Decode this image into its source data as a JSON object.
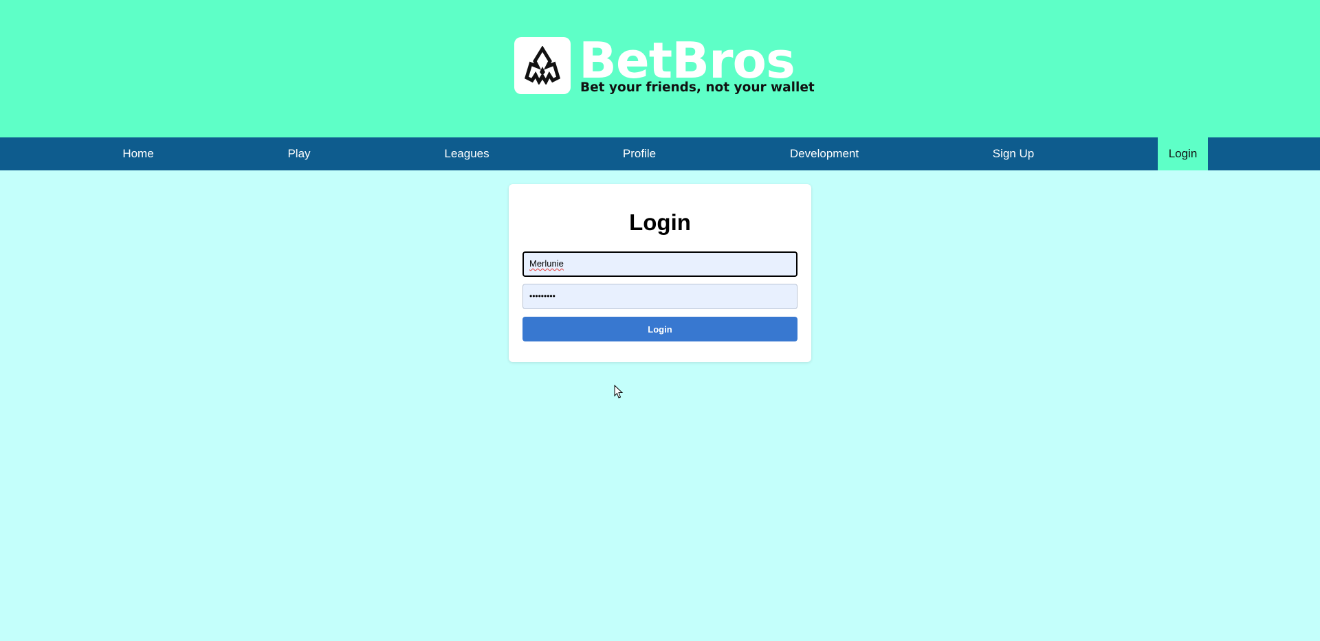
{
  "brand": {
    "name": "BetBros",
    "tagline": "Bet your friends, not your wallet",
    "logo_icon": "flame-crown-icon",
    "header_color": "#5effc7"
  },
  "nav": {
    "background": "#0e5c8e",
    "items": [
      {
        "label": "Home"
      },
      {
        "label": "Play"
      },
      {
        "label": "Leagues"
      },
      {
        "label": "Profile"
      },
      {
        "label": "Development"
      },
      {
        "label": "Sign Up"
      },
      {
        "label": "Login",
        "active": true
      }
    ]
  },
  "login": {
    "title": "Login",
    "username_value": "Merlunie",
    "password_mask": "•••••••••",
    "button_label": "Login",
    "button_color": "#3878d0"
  },
  "page": {
    "background": "#c4fffb"
  }
}
